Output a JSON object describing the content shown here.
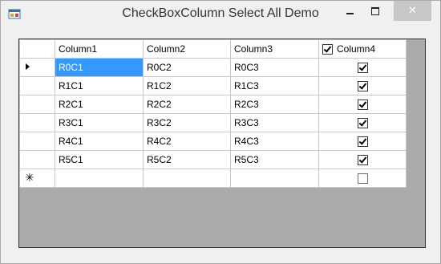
{
  "window": {
    "title": "CheckBoxColumn Select All Demo",
    "close_glyph": "✕"
  },
  "grid": {
    "columns": [
      "Column1",
      "Column2",
      "Column3",
      "Column4"
    ],
    "header_checkbox_checked": true,
    "rows": [
      {
        "c1": "R0C1",
        "c2": "R0C2",
        "c3": "R0C3",
        "checked": true
      },
      {
        "c1": "R1C1",
        "c2": "R1C2",
        "c3": "R1C3",
        "checked": true
      },
      {
        "c1": "R2C1",
        "c2": "R2C2",
        "c3": "R2C3",
        "checked": true
      },
      {
        "c1": "R3C1",
        "c2": "R3C2",
        "c3": "R3C3",
        "checked": true
      },
      {
        "c1": "R4C1",
        "c2": "R4C2",
        "c3": "R4C3",
        "checked": true
      },
      {
        "c1": "R5C1",
        "c2": "R5C2",
        "c3": "R5C3",
        "checked": true
      }
    ],
    "new_row_glyph": "✳",
    "new_row_checked": false,
    "selection_color": "#3399ff",
    "empty_area_color": "#ababab"
  }
}
